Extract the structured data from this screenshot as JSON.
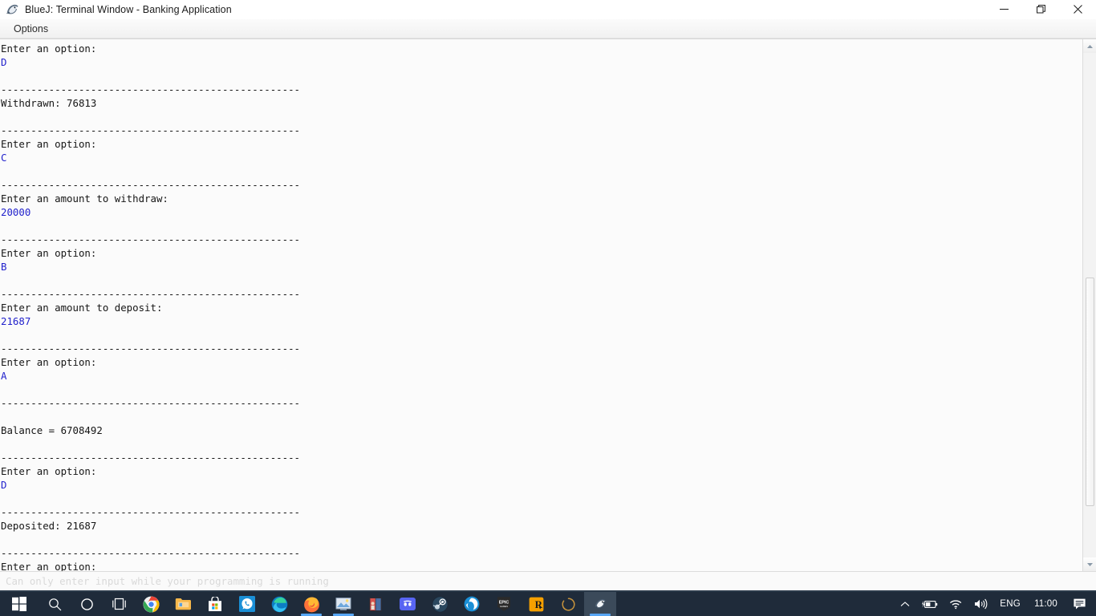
{
  "window": {
    "title": "BlueJ: Terminal Window - Banking Application",
    "app_icon": "bluej-icon",
    "controls": {
      "minimize": "minimize-button",
      "restore": "restore-button",
      "close": "close-button"
    }
  },
  "menubar": {
    "items": [
      {
        "label": "Options",
        "name": "menu-item-options"
      }
    ]
  },
  "terminal": {
    "separator": "--------------------------------------------------",
    "lines": [
      {
        "text": "Enter an option:",
        "kind": "output"
      },
      {
        "text": "D",
        "kind": "input"
      },
      {
        "text": "",
        "kind": "blank"
      },
      {
        "text": "--------------------------------------------------",
        "kind": "output"
      },
      {
        "text": "Withdrawn: 76813",
        "kind": "output"
      },
      {
        "text": "",
        "kind": "blank"
      },
      {
        "text": "--------------------------------------------------",
        "kind": "output"
      },
      {
        "text": "Enter an option:",
        "kind": "output"
      },
      {
        "text": "C",
        "kind": "input"
      },
      {
        "text": "",
        "kind": "blank"
      },
      {
        "text": "--------------------------------------------------",
        "kind": "output"
      },
      {
        "text": "Enter an amount to withdraw:",
        "kind": "output"
      },
      {
        "text": "20000",
        "kind": "input"
      },
      {
        "text": "",
        "kind": "blank"
      },
      {
        "text": "--------------------------------------------------",
        "kind": "output"
      },
      {
        "text": "Enter an option:",
        "kind": "output"
      },
      {
        "text": "B",
        "kind": "input"
      },
      {
        "text": "",
        "kind": "blank"
      },
      {
        "text": "--------------------------------------------------",
        "kind": "output"
      },
      {
        "text": "Enter an amount to deposit:",
        "kind": "output"
      },
      {
        "text": "21687",
        "kind": "input"
      },
      {
        "text": "",
        "kind": "blank"
      },
      {
        "text": "--------------------------------------------------",
        "kind": "output"
      },
      {
        "text": "Enter an option:",
        "kind": "output"
      },
      {
        "text": "A",
        "kind": "input"
      },
      {
        "text": "",
        "kind": "blank"
      },
      {
        "text": "--------------------------------------------------",
        "kind": "output"
      },
      {
        "text": "",
        "kind": "blank"
      },
      {
        "text": "Balance = 6708492",
        "kind": "output"
      },
      {
        "text": "",
        "kind": "blank"
      },
      {
        "text": "--------------------------------------------------",
        "kind": "output"
      },
      {
        "text": "Enter an option:",
        "kind": "output"
      },
      {
        "text": "D",
        "kind": "input"
      },
      {
        "text": "",
        "kind": "blank"
      },
      {
        "text": "--------------------------------------------------",
        "kind": "output"
      },
      {
        "text": "Deposited: 21687",
        "kind": "output"
      },
      {
        "text": "",
        "kind": "blank"
      },
      {
        "text": "--------------------------------------------------",
        "kind": "output"
      },
      {
        "text": "Enter an option:",
        "kind": "output"
      }
    ]
  },
  "scrollbar": {
    "up_arrow": "scroll-up-arrow",
    "down_arrow": "scroll-down-arrow",
    "thumb": "scroll-thumb"
  },
  "statusbar": {
    "message": "Can only enter input while your programming is running"
  },
  "taskbar": {
    "start": {
      "name": "start-button",
      "icon": "windows-logo-icon"
    },
    "items": [
      {
        "name": "taskbar-search",
        "icon": "search-icon",
        "state": ""
      },
      {
        "name": "taskbar-cortana",
        "icon": "cortana-circle-icon",
        "state": ""
      },
      {
        "name": "taskbar-task-view",
        "icon": "task-view-icon",
        "state": ""
      },
      {
        "name": "taskbar-chrome",
        "icon": "chrome-icon",
        "state": ""
      },
      {
        "name": "taskbar-file-explorer",
        "icon": "folder-icon",
        "state": ""
      },
      {
        "name": "taskbar-microsoft-store",
        "icon": "store-bag-icon",
        "state": ""
      },
      {
        "name": "taskbar-whatsapp",
        "icon": "whatsapp-icon",
        "state": ""
      },
      {
        "name": "taskbar-edge",
        "icon": "edge-icon",
        "state": ""
      },
      {
        "name": "taskbar-firefox",
        "icon": "firefox-icon",
        "state": "running"
      },
      {
        "name": "taskbar-photos",
        "icon": "photos-icon",
        "state": "running"
      },
      {
        "name": "taskbar-media",
        "icon": "media-app-icon",
        "state": ""
      },
      {
        "name": "taskbar-discord",
        "icon": "discord-icon",
        "state": ""
      },
      {
        "name": "taskbar-steam",
        "icon": "steam-icon",
        "state": ""
      },
      {
        "name": "taskbar-ubisoft",
        "icon": "ubisoft-icon",
        "state": ""
      },
      {
        "name": "taskbar-epic-games",
        "icon": "epic-games-icon",
        "state": ""
      },
      {
        "name": "taskbar-rockstar",
        "icon": "rockstar-icon",
        "state": ""
      },
      {
        "name": "taskbar-loading",
        "icon": "loading-circle-icon",
        "state": ""
      },
      {
        "name": "taskbar-bluej",
        "icon": "bluej-icon",
        "state": "active"
      }
    ],
    "tray": {
      "chevron": "chevron-up-icon",
      "battery": "battery-charging-icon",
      "wifi": "wifi-icon",
      "volume": "volume-icon",
      "language": "ENG",
      "clock": "11:00",
      "notifications": "notifications-icon"
    }
  },
  "colors": {
    "terminal_bg": "#fbfbfb",
    "output_text": "#161616",
    "input_text": "#2222cc",
    "taskbar_bg": "#1f2b3a",
    "accent": "#57a6f5"
  }
}
